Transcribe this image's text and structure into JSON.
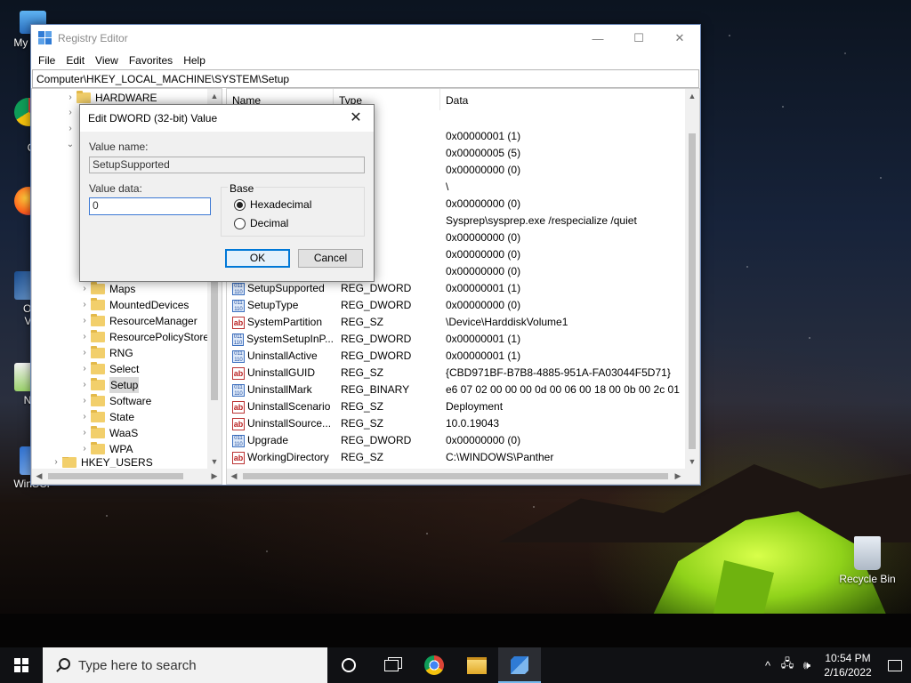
{
  "desktop": {
    "icons": [
      {
        "label": "My Co",
        "icon": "this-pc-icon"
      },
      {
        "label": "Go",
        "label2": "Chr",
        "icon": "chrome-icon"
      },
      {
        "label": "Fir",
        "icon": "firefox-icon"
      },
      {
        "label": "Orac",
        "label2": "Virtu",
        "icon": "virtualbox-icon"
      },
      {
        "label": "Note",
        "icon": "notepad-plus-icon"
      },
      {
        "label": "WinSCP",
        "icon": "winscp-icon"
      },
      {
        "label": "Recycle Bin",
        "icon": "recycle-bin-icon"
      }
    ]
  },
  "window": {
    "title": "Registry Editor",
    "controls": {
      "minimize": "—",
      "maximize": "☐",
      "close": "✕"
    },
    "menu": [
      "File",
      "Edit",
      "View",
      "Favorites",
      "Help"
    ],
    "address": "Computer\\HKEY_LOCAL_MACHINE\\SYSTEM\\Setup",
    "tree": {
      "top_item": "HARDWARE",
      "items": [
        "Maps",
        "MountedDevices",
        "ResourceManager",
        "ResourcePolicyStore",
        "RNG",
        "Select",
        "Setup",
        "Software",
        "State",
        "WaaS",
        "WPA"
      ],
      "bottom_item": "HKEY_USERS",
      "selected": "Setup"
    },
    "list": {
      "columns": [
        "Name",
        "Type",
        "Data"
      ],
      "partial_rows": [
        {
          "type": "WORD",
          "data": "0x00000001 (1)"
        },
        {
          "type": "WORD",
          "data": "0x00000005 (5)"
        },
        {
          "type": "WORD",
          "data": "0x00000000 (0)"
        },
        {
          "type": "",
          "data": "\\"
        },
        {
          "type": "WORD",
          "data": "0x00000000 (0)"
        },
        {
          "type": "",
          "data": "Sysprep\\sysprep.exe /respecialize /quiet"
        },
        {
          "type": "WORD",
          "data": "0x00000000 (0)"
        },
        {
          "type": "WORD",
          "data": "0x00000000 (0)"
        },
        {
          "type": "WORD",
          "data": "0x00000000 (0)"
        }
      ],
      "rows": [
        {
          "name": "SetupSupported",
          "type": "REG_DWORD",
          "data": "0x00000001 (1)",
          "icon": "dword"
        },
        {
          "name": "SetupType",
          "type": "REG_DWORD",
          "data": "0x00000000 (0)",
          "icon": "dword"
        },
        {
          "name": "SystemPartition",
          "type": "REG_SZ",
          "data": "\\Device\\HarddiskVolume1",
          "icon": "sz"
        },
        {
          "name": "SystemSetupInP...",
          "type": "REG_DWORD",
          "data": "0x00000001 (1)",
          "icon": "dword"
        },
        {
          "name": "UninstallActive",
          "type": "REG_DWORD",
          "data": "0x00000001 (1)",
          "icon": "dword"
        },
        {
          "name": "UninstallGUID",
          "type": "REG_SZ",
          "data": "{CBD971BF-B7B8-4885-951A-FA03044F5D71}",
          "icon": "sz"
        },
        {
          "name": "UninstallMark",
          "type": "REG_BINARY",
          "data": "e6 07 02 00 00 00 0d 00 06 00 18 00 0b 00 2c 01",
          "icon": "dword"
        },
        {
          "name": "UninstallScenario",
          "type": "REG_SZ",
          "data": "Deployment",
          "icon": "sz"
        },
        {
          "name": "UninstallSource...",
          "type": "REG_SZ",
          "data": "10.0.19043",
          "icon": "sz"
        },
        {
          "name": "Upgrade",
          "type": "REG_DWORD",
          "data": "0x00000000 (0)",
          "icon": "dword"
        },
        {
          "name": "WorkingDirectory",
          "type": "REG_SZ",
          "data": "C:\\WINDOWS\\Panther",
          "icon": "sz"
        }
      ]
    }
  },
  "dialog": {
    "title": "Edit DWORD (32-bit) Value",
    "close": "✕",
    "value_name_label": "Value name:",
    "value_name": "SetupSupported",
    "value_data_label": "Value data:",
    "value_data": "0",
    "base_label": "Base",
    "base_options": [
      {
        "label": "Hexadecimal",
        "selected": true
      },
      {
        "label": "Decimal",
        "selected": false
      }
    ],
    "ok": "OK",
    "cancel": "Cancel"
  },
  "taskbar": {
    "search_placeholder": "Type here to search",
    "time": "10:54 PM",
    "date": "2/16/2022",
    "tray": {
      "chevron": "^",
      "network": "🖧",
      "volume": "🕪"
    }
  }
}
